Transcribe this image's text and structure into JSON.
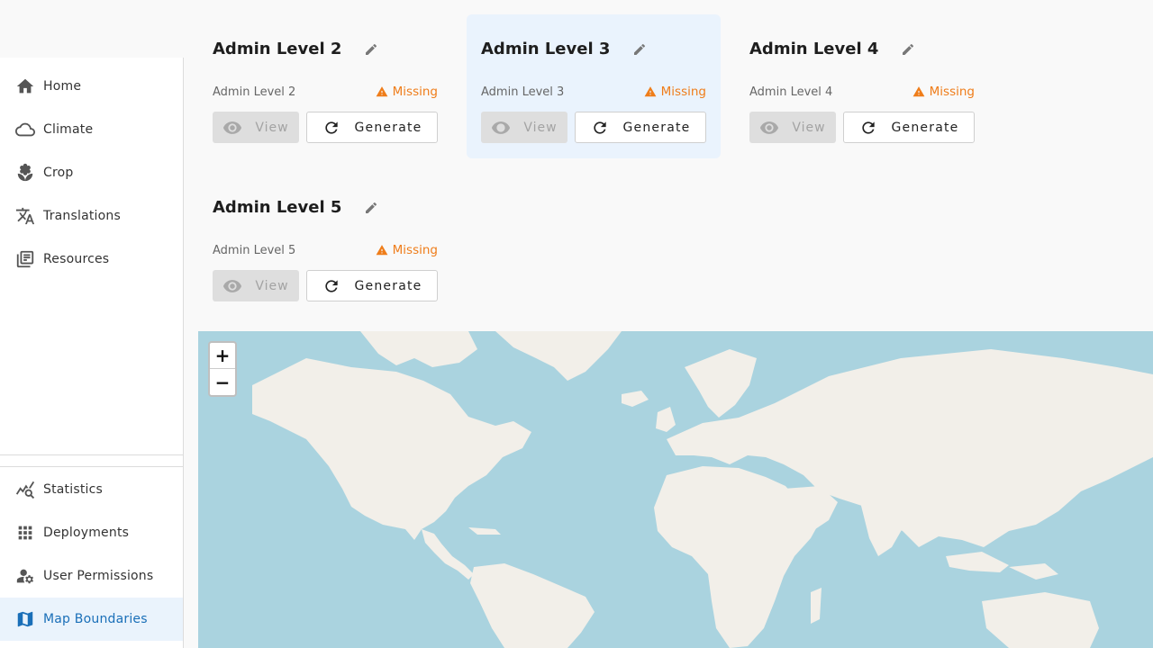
{
  "sidebar": {
    "top_items": [
      {
        "label": "Home",
        "icon": "home-icon"
      },
      {
        "label": "Climate",
        "icon": "cloud-icon"
      },
      {
        "label": "Crop",
        "icon": "sprout-icon"
      },
      {
        "label": "Translations",
        "icon": "translate-icon"
      },
      {
        "label": "Resources",
        "icon": "library-icon"
      }
    ],
    "bottom_items": [
      {
        "label": "Statistics",
        "icon": "chart-search-icon"
      },
      {
        "label": "Deployments",
        "icon": "grid-icon"
      },
      {
        "label": "User Permissions",
        "icon": "user-settings-icon"
      },
      {
        "label": "Map Boundaries",
        "icon": "map-icon",
        "active": true
      }
    ],
    "active_color": "#1a6fb8"
  },
  "cards": [
    {
      "title": "Admin Level 2",
      "subtitle": "Admin Level 2",
      "status": "Missing",
      "view_label": "View",
      "generate_label": "Generate"
    },
    {
      "title": "Admin Level 3",
      "subtitle": "Admin Level 3",
      "status": "Missing",
      "view_label": "View",
      "generate_label": "Generate",
      "highlighted": true
    },
    {
      "title": "Admin Level 4",
      "subtitle": "Admin Level 4",
      "status": "Missing",
      "view_label": "View",
      "generate_label": "Generate"
    },
    {
      "title": "Admin Level 5",
      "subtitle": "Admin Level 5",
      "status": "Missing",
      "view_label": "View",
      "generate_label": "Generate"
    }
  ],
  "status_color": "#ef7d1a",
  "map": {
    "zoom_in_label": "+",
    "zoom_out_label": "−",
    "water_color": "#aad3df",
    "land_color": "#f2efe9"
  }
}
